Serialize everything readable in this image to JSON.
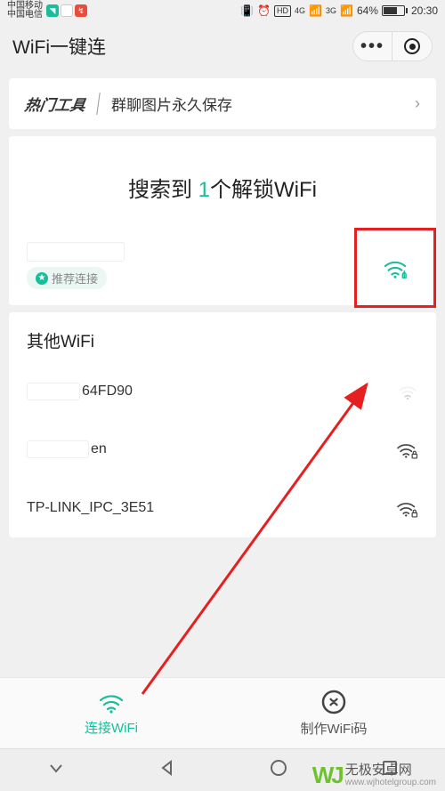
{
  "statusBar": {
    "carrier1": "中国移动",
    "carrier2": "中国电信",
    "hd": "HD",
    "net1": "4G",
    "net2": "3G",
    "battery": "64%",
    "time": "20:30"
  },
  "header": {
    "title": "WiFi一键连"
  },
  "toolBanner": {
    "label": "热门工具",
    "desc": "群聊图片永久保存"
  },
  "found": {
    "prefix": "搜索到 ",
    "count": "1",
    "suffix": "个解锁WiFi",
    "recommend": "推荐连接"
  },
  "other": {
    "title": "其他WiFi",
    "item1_suffix": "64FD90",
    "item2_suffix": "en",
    "item3": "TP-LINK_IPC_3E51"
  },
  "tabs": {
    "connect": "连接WiFi",
    "make": "制作WiFi码"
  },
  "watermark": {
    "brand": "无极安卓网",
    "url": "www.wjhotelgroup.com"
  }
}
